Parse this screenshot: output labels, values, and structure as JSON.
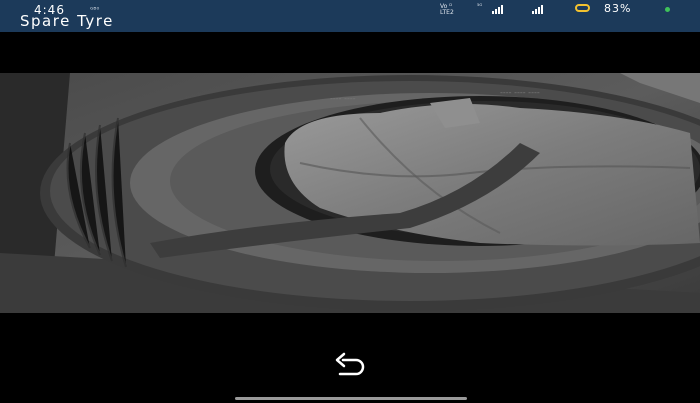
{
  "status_bar": {
    "time": "4:46",
    "notification": "ᴳᴮ⁰",
    "network_line1": "Vo ᴰ",
    "network_line2": "LTE2",
    "network_5g": "⁵ᴳ",
    "battery": "83%",
    "battery_color": "#f2c230",
    "dot_color": "#3fc25a"
  },
  "header": {
    "title": "Spare Tyre"
  },
  "image": {
    "alt_icon": "spare-tyre-photo"
  },
  "controls": {
    "undo_icon": "undo-arrow-icon"
  }
}
